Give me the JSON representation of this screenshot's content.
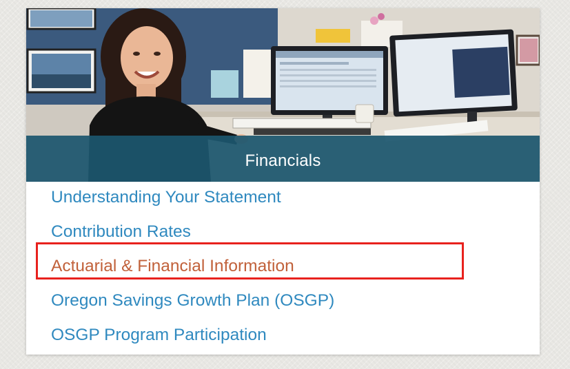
{
  "card": {
    "banner_title": "Financials",
    "hero_image": "woman-at-desk-with-dual-monitors-photo"
  },
  "links": [
    {
      "label": "Understanding Your Statement",
      "active": false
    },
    {
      "label": "Contribution Rates",
      "active": false
    },
    {
      "label": "Actuarial & Financial Information",
      "active": true
    },
    {
      "label": "Oregon Savings Growth Plan (OSGP)",
      "active": false
    },
    {
      "label": "OSGP Program Participation",
      "active": false
    }
  ],
  "colors": {
    "link": "#2f89bf",
    "active_link": "#c1613a",
    "banner": "#1c566e",
    "highlight_border": "#e8211d",
    "page_background": "#e9e8e4"
  }
}
